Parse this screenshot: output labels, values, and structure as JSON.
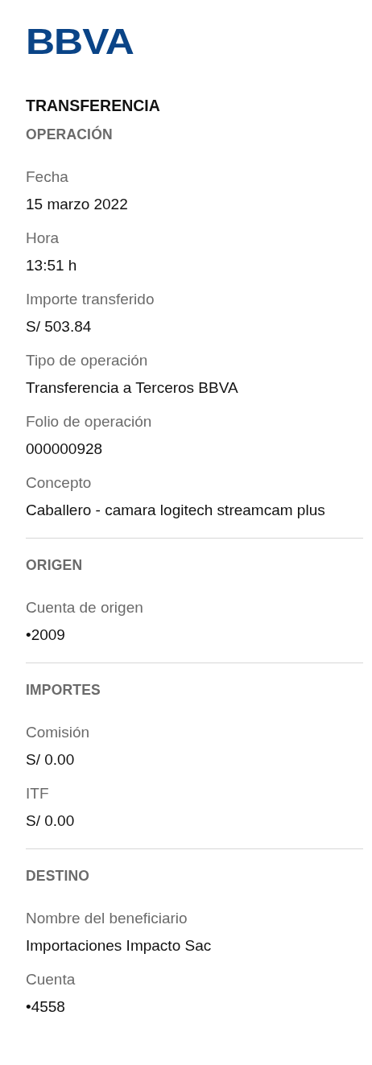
{
  "logo": "BBVA",
  "title": "TRANSFERENCIA",
  "sections": [
    {
      "header": "OPERACIÓN",
      "fields": [
        {
          "label": "Fecha",
          "value": "15 marzo 2022"
        },
        {
          "label": "Hora",
          "value": "13:51 h"
        },
        {
          "label": "Importe transferido",
          "value": "S/ 503.84"
        },
        {
          "label": "Tipo de operación",
          "value": "Transferencia a Terceros BBVA"
        },
        {
          "label": "Folio de operación",
          "value": "000000928"
        },
        {
          "label": "Concepto",
          "value": "Caballero - camara logitech streamcam plus"
        }
      ]
    },
    {
      "header": "ORIGEN",
      "fields": [
        {
          "label": "Cuenta de origen",
          "value": "•2009"
        }
      ]
    },
    {
      "header": "IMPORTES",
      "fields": [
        {
          "label": "Comisión",
          "value": "S/ 0.00"
        },
        {
          "label": "ITF",
          "value": "S/ 0.00"
        }
      ]
    },
    {
      "header": "DESTINO",
      "fields": [
        {
          "label": "Nombre del beneficiario",
          "value": "Importaciones Impacto Sac"
        },
        {
          "label": "Cuenta",
          "value": "•4558"
        }
      ]
    }
  ]
}
